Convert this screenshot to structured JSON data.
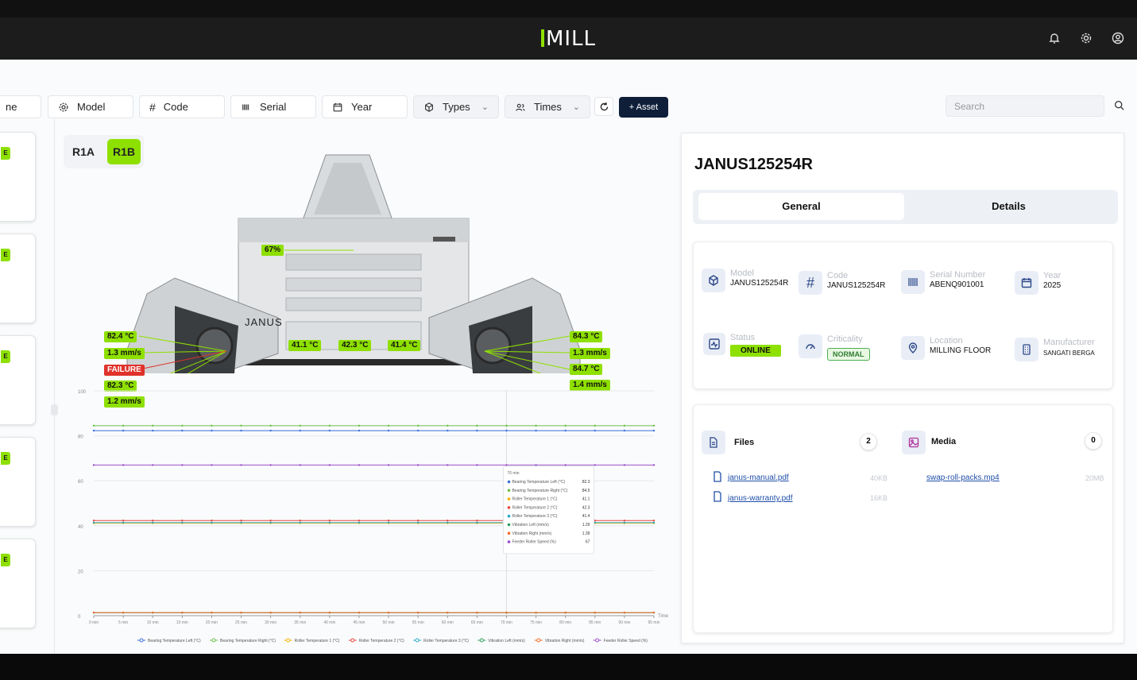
{
  "header": {
    "logo": "MILL"
  },
  "filters": {
    "name_partial": "ne",
    "model": "Model",
    "code": "Code",
    "serial": "Serial",
    "year": "Year",
    "types": "Types",
    "times": "Times",
    "add_asset": "+ Asset",
    "search_placeholder": "Search"
  },
  "left_cards": [
    {
      "tag": "E"
    },
    {
      "tag": "E"
    },
    {
      "tag": "E"
    },
    {
      "tag": "E"
    },
    {
      "tag": "E"
    }
  ],
  "roll_tabs": {
    "r1a": "R1A",
    "r1b": "R1B",
    "active": "R1B"
  },
  "machine": {
    "brand_text": "JANUS",
    "feeder_percent": "67%",
    "left_labels": [
      "82.4 °C",
      "1.3 mm/s",
      "FAILURE",
      "82.3 °C",
      "1.2 mm/s"
    ],
    "center_labels": [
      "41.1 °C",
      "42.3 °C",
      "41.4 °C"
    ],
    "right_labels": [
      "84.3 °C",
      "1.3 mm/s",
      "84.7 °C",
      "1.4 mm/s"
    ]
  },
  "chart_data": {
    "type": "line",
    "x": [
      "0 min",
      "5 min",
      "10 min",
      "15 min",
      "20 min",
      "25 min",
      "30 min",
      "35 min",
      "40 min",
      "45 min",
      "50 min",
      "55 min",
      "60 min",
      "65 min",
      "70 min",
      "75 min",
      "80 min",
      "85 min",
      "90 min",
      "95 min"
    ],
    "xlabel": "Time",
    "ylim": [
      0,
      100
    ],
    "yticks": [
      0,
      20,
      40,
      60,
      80,
      100
    ],
    "series": [
      {
        "name": "Bearing Temperature Left (°C)",
        "color": "#3b6fd8",
        "values": [
          82.3,
          82.3,
          82.3,
          82.3,
          82.3,
          82.3,
          82.3,
          82.3,
          82.3,
          82.3,
          82.3,
          82.3,
          82.3,
          82.3,
          82.3,
          82.3,
          82.3,
          82.3,
          82.3,
          82.3
        ]
      },
      {
        "name": "Bearing Temperature Right (°C)",
        "color": "#6cc04a",
        "values": [
          84.5,
          84.5,
          84.5,
          84.5,
          84.5,
          84.5,
          84.5,
          84.5,
          84.5,
          84.5,
          84.5,
          84.5,
          84.5,
          84.5,
          84.5,
          84.5,
          84.5,
          84.5,
          84.5,
          84.5
        ]
      },
      {
        "name": "Roller Temperature 1 (°C)",
        "color": "#f4b400",
        "values": [
          41.1,
          41.1,
          41.1,
          41.1,
          41.1,
          41.1,
          41.1,
          41.1,
          41.1,
          41.1,
          41.1,
          41.1,
          41.1,
          41.1,
          41.1,
          41.1,
          41.1,
          41.1,
          41.1,
          41.1
        ]
      },
      {
        "name": "Roller Temperature 2 (°C)",
        "color": "#e8473c",
        "values": [
          42.3,
          42.3,
          42.3,
          42.3,
          42.3,
          42.3,
          42.3,
          42.3,
          42.3,
          42.3,
          42.3,
          42.3,
          42.3,
          42.3,
          42.3,
          42.3,
          42.3,
          42.3,
          42.3,
          42.3
        ]
      },
      {
        "name": "Roller Temperature 3 (°C)",
        "color": "#29a8c9",
        "values": [
          41.4,
          41.4,
          41.4,
          41.4,
          41.4,
          41.4,
          41.4,
          41.4,
          41.4,
          41.4,
          41.4,
          41.4,
          41.4,
          41.4,
          41.4,
          41.4,
          41.4,
          41.4,
          41.4,
          41.4
        ]
      },
      {
        "name": "Vibration Left (mm/s)",
        "color": "#2e9e5a",
        "values": [
          1.29,
          1.29,
          1.29,
          1.29,
          1.29,
          1.29,
          1.29,
          1.29,
          1.29,
          1.29,
          1.29,
          1.29,
          1.29,
          1.29,
          1.29,
          1.29,
          1.29,
          1.29,
          1.29,
          1.29
        ]
      },
      {
        "name": "Vibration Right (mm/s)",
        "color": "#f26b2a",
        "values": [
          1.39,
          1.39,
          1.39,
          1.39,
          1.39,
          1.39,
          1.39,
          1.39,
          1.39,
          1.39,
          1.39,
          1.39,
          1.39,
          1.39,
          1.39,
          1.39,
          1.39,
          1.39,
          1.39,
          1.39
        ]
      },
      {
        "name": "Feeder Roller Speed (%)",
        "color": "#9b4fc7",
        "values": [
          67,
          67,
          67,
          67,
          67,
          67,
          67,
          67,
          67,
          67,
          67,
          67,
          67,
          67,
          67,
          67,
          67,
          67,
          67,
          67
        ]
      }
    ],
    "tooltip": {
      "title": "70 min",
      "rows": [
        {
          "label": "Bearing Temperature Left (°C)",
          "value": "82.3"
        },
        {
          "label": "Bearing Temperature Right (°C)",
          "value": "84.5"
        },
        {
          "label": "Roller Temperature 1 (°C)",
          "value": "41.1"
        },
        {
          "label": "Roller Temperature 2 (°C)",
          "value": "42.3"
        },
        {
          "label": "Roller Temperature 3 (°C)",
          "value": "41.4"
        },
        {
          "label": "Vibration Left (mm/s)",
          "value": "1.29"
        },
        {
          "label": "Vibration Right (mm/s)",
          "value": "1.39"
        },
        {
          "label": "Feeder Roller Speed (%)",
          "value": "67"
        }
      ]
    },
    "grid": true,
    "legend": "bottom"
  },
  "panel": {
    "title": "JANUS125254R",
    "tab_general": "General",
    "tab_details": "Details",
    "model_label": "Model",
    "model_value": "JANUS125254R",
    "code_label": "Code",
    "code_value": "JANUS125254R",
    "serial_label": "Serial Number",
    "serial_value": "ABENQ901001",
    "year_label": "Year",
    "year_value": "2025",
    "status_label": "Status",
    "status_value": "ONLINE",
    "criticality_label": "Criticality",
    "criticality_value": "NORMAL",
    "location_label": "Location",
    "location_value": "MILLING FLOOR",
    "manufacturer_label": "Manufacturer",
    "manufacturer_value": "SANGATI BERGA",
    "files_label": "Files",
    "files_count": "2",
    "media_label": "Media",
    "media_count": "0",
    "files": [
      {
        "name": "janus-manual.pdf",
        "size": "40KB"
      },
      {
        "name": "janus-warranty.pdf",
        "size": "16KB"
      }
    ],
    "media": [
      {
        "name": "swap-roll-packs.mp4",
        "size": "20MB"
      }
    ]
  }
}
